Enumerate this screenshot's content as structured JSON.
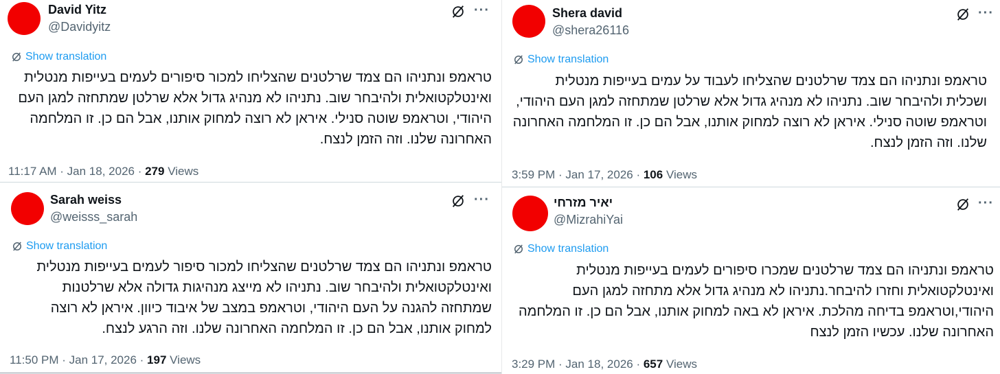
{
  "colors": {
    "avatar": "#f20000",
    "link": "#1d9bf0",
    "muted": "#536471",
    "text": "#0f1419"
  },
  "icons": {
    "grok": "grok-slash-circle-icon",
    "more": "more-dots-icon",
    "translate": "translate-icon"
  },
  "tweets": [
    {
      "name": "David Yitz",
      "handle": "@Davidyitz",
      "translate": "Show translation",
      "lines": [
        "טראמפ ונתניהו הם צמד שרלטנים שהצליחו למכור סיפורים לעמים בעייפות מנטלית",
        "ואינטלקטואלית ולהיבחר שוב. נתניהו לא מנהיג גדול אלא שרלטן שמתחזה למגן העם",
        "היהודי, וטראמפ שוטה סנילי. איראן לא רוצה למחוק אותנו, אבל הם כן. זו המלחמה",
        "האחרונה שלנו. וזה הזמן לנצח."
      ],
      "time": "11:17 AM · Jan 18, 2026 · ",
      "views_count": "279",
      "views_label": " Views",
      "more": "···"
    },
    {
      "name": "Shera david",
      "handle": "@shera26116",
      "translate": "Show translation",
      "lines": [
        "טראמפ ונתניהו הם צמד שרלטנים שהצליחו לעבוד על עמים בעייפות מנטלית",
        "ושכלית ולהיבחר שוב. נתניהו לא מנהיג גדול אלא שרלטן שמתחזה למגן העם היהודי,",
        "וטראמפ שוטה סנילי. איראן לא רוצה למחוק אותנו, אבל הם כן. זו המלחמה האחרונה",
        "שלנו. וזה הזמן לנצח."
      ],
      "time": "3:59 PM · Jan 17, 2026 · ",
      "views_count": "106",
      "views_label": " Views",
      "more": "···"
    },
    {
      "name": "Sarah weiss",
      "handle": "@weisss_sarah",
      "translate": "Show translation",
      "lines": [
        "טראמפ ונתניהו הם צמד שרלטנים שהצליחו למכור סיפור לעמים בעייפות מנטלית",
        "ואינטלקטואלית ולהיבחר שוב. נתניהו לא מייצג מנהיגות גדולה אלא שרלטנות",
        "שמתחזה להגנה על העם היהודי, וטראמפ במצב של איבוד כיוון. איראן לא רוצה",
        "למחוק אותנו, אבל הם כן. זו המלחמה האחרונה שלנו. וזה הרגע לנצח."
      ],
      "time": "11:50 PM · Jan 17, 2026 · ",
      "views_count": "197",
      "views_label": " Views",
      "more": "···"
    },
    {
      "name": "יאיר מזרחי",
      "handle": "@MizrahiYai",
      "translate": "Show translation",
      "lines": [
        "טראמפ ונתניהו הם צמד שרלטנים שמכרו סיפורים לעמים בעייפות מנטלית",
        "ואינטלקטואלית וחזרו להיבחר.נתניהו לא מנהיג גדול אלא מתחזה למגן העם",
        "היהודי,וטראמפ בדיחה מהלכת. איראן לא באה למחוק אותנו, אבל הם כן. זו המלחמה",
        "האחרונה שלנו. עכשיו הזמן לנצח"
      ],
      "time": "3:29 PM · Jan 18, 2026 · ",
      "views_count": "657",
      "views_label": " Views",
      "more": "···"
    }
  ]
}
